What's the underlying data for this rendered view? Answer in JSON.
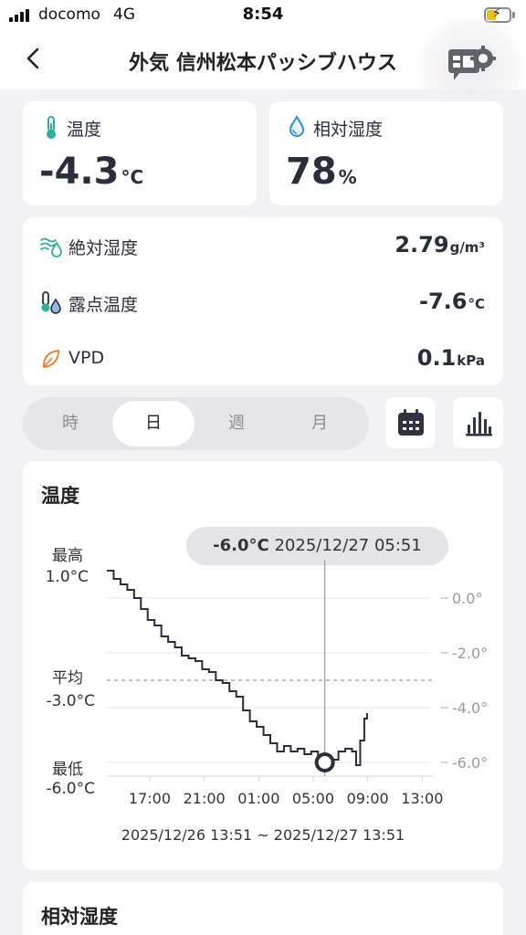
{
  "status_bar": {
    "carrier": "docomo",
    "network": "4G",
    "time": "8:54"
  },
  "nav": {
    "title": "外気 信州松本パッシブハウス",
    "back_icon": "chevron-left-icon",
    "settings_icon": "chat-gear-icon"
  },
  "temperature": {
    "label": "温度",
    "value": "-4.3",
    "unit": "°C",
    "icon": "thermometer-icon"
  },
  "humidity": {
    "label": "相対湿度",
    "value": "78",
    "unit": "%",
    "icon": "water-drop-icon"
  },
  "metrics": [
    {
      "label": "絶対湿度",
      "value": "2.79",
      "unit": "g/m³",
      "icon": "absolute-humidity-icon"
    },
    {
      "label": "露点温度",
      "value": "-7.6",
      "unit": "°C",
      "icon": "dew-point-icon"
    },
    {
      "label": "VPD",
      "value": "0.1",
      "unit": "kPa",
      "icon": "leaf-icon"
    }
  ],
  "period_tabs": [
    {
      "label": "時",
      "active": false
    },
    {
      "label": "日",
      "active": true
    },
    {
      "label": "週",
      "active": false
    },
    {
      "label": "月",
      "active": false
    }
  ],
  "toolbar_icons": [
    "calendar-icon",
    "bar-chart-icon"
  ],
  "temp_chart": {
    "title": "温度",
    "tooltip_value": "-6.0°C",
    "tooltip_time": "2025/12/27 05:51",
    "max_label": "最高",
    "max_value": "1.0°C",
    "avg_label": "平均",
    "avg_value": "-3.0°C",
    "min_label": "最低",
    "min_value": "-6.0°C",
    "date_range": "2025/12/26 13:51 ~ 2025/12/27 13:51"
  },
  "chart_data": {
    "type": "line",
    "title": "温度",
    "xlabel": "",
    "ylabel": "",
    "x_tick_labels": [
      "17:00",
      "21:00",
      "01:00",
      "05:00",
      "09:00",
      "13:00"
    ],
    "y_tick_labels": [
      "0.0°",
      "-2.0°",
      "-4.0°",
      "-6.0°"
    ],
    "ylim": [
      -6.5,
      1.0
    ],
    "x_unit": "hours since 13:51",
    "average": -3.0,
    "highlight": {
      "x": 16.0,
      "y": -6.0,
      "label": "2025/12/27 05:51"
    },
    "series": [
      {
        "points": [
          [
            0.0,
            1.0
          ],
          [
            0.5,
            0.7
          ],
          [
            1.0,
            0.5
          ],
          [
            1.5,
            0.3
          ],
          [
            2.0,
            0.0
          ],
          [
            2.5,
            -0.4
          ],
          [
            3.0,
            -0.8
          ],
          [
            3.5,
            -1.0
          ],
          [
            4.0,
            -1.4
          ],
          [
            4.5,
            -1.6
          ],
          [
            5.0,
            -1.8
          ],
          [
            5.5,
            -2.1
          ],
          [
            6.0,
            -2.2
          ],
          [
            6.5,
            -2.3
          ],
          [
            7.0,
            -2.6
          ],
          [
            7.5,
            -2.7
          ],
          [
            8.0,
            -3.0
          ],
          [
            8.5,
            -3.1
          ],
          [
            9.0,
            -3.4
          ],
          [
            9.5,
            -3.6
          ],
          [
            10.0,
            -4.1
          ],
          [
            10.5,
            -4.5
          ],
          [
            11.0,
            -4.7
          ],
          [
            11.5,
            -5.0
          ],
          [
            12.0,
            -5.3
          ],
          [
            12.5,
            -5.6
          ],
          [
            13.0,
            -5.4
          ],
          [
            13.5,
            -5.6
          ],
          [
            14.0,
            -5.5
          ],
          [
            14.5,
            -5.7
          ],
          [
            15.0,
            -5.6
          ],
          [
            15.5,
            -5.9
          ],
          [
            16.0,
            -6.0
          ],
          [
            16.5,
            -5.9
          ],
          [
            17.0,
            -5.6
          ],
          [
            17.5,
            -5.5
          ],
          [
            18.0,
            -5.6
          ],
          [
            18.3,
            -6.1
          ],
          [
            18.6,
            -5.2
          ],
          [
            18.9,
            -4.4
          ],
          [
            19.1,
            -4.2
          ]
        ]
      }
    ]
  },
  "rh_chart": {
    "title": "相対湿度"
  }
}
